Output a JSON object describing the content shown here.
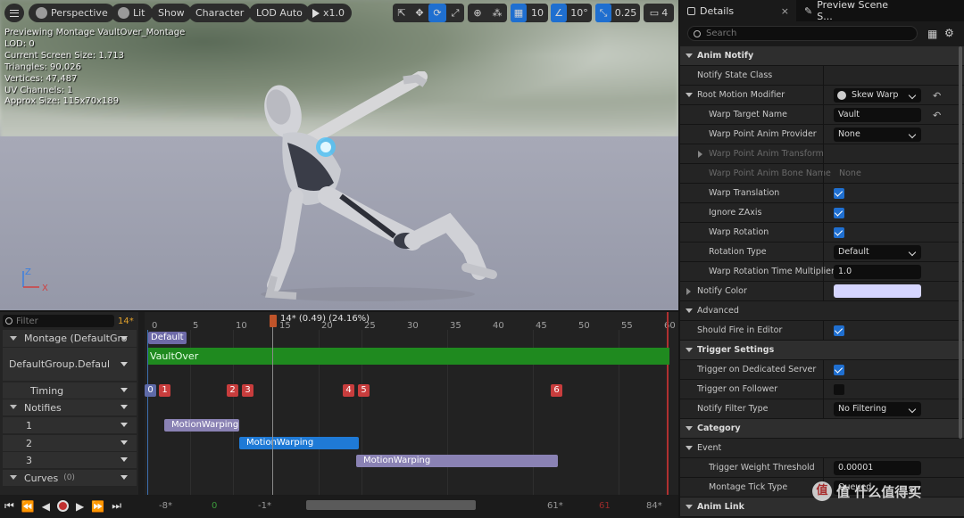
{
  "viewport": {
    "toolbar": {
      "perspective": "Perspective",
      "lit": "Lit",
      "show": "Show",
      "character": "Character",
      "lod": "LOD Auto",
      "play_speed": "x1.0",
      "grid_snap": "10",
      "angle_snap": "10°",
      "scale_snap": "0.25",
      "camera_speed": "4"
    },
    "stats": [
      "Previewing Montage VaultOver_Montage",
      "LOD: 0",
      "Current Screen Size: 1.713",
      "Triangles: 90,026",
      "Vertices: 47,487",
      "UV Channels: 1",
      "Approx Size: 115x70x189"
    ],
    "axis": {
      "z": "Z",
      "x": "X"
    }
  },
  "timeline": {
    "filter_placeholder": "Filter",
    "current_frame": "14*",
    "playhead_label": "14* (0.49) (24.16%)",
    "ticks": [
      "0",
      "5",
      "10",
      "15",
      "20",
      "25",
      "30",
      "35",
      "40",
      "45",
      "50",
      "55",
      "60"
    ],
    "rows": {
      "montage": "Montage (DefaultGro",
      "group": "DefaultGroup.Defaul",
      "timing": "Timing",
      "notifies": "Notifies",
      "track1": "1",
      "track2": "2",
      "track3": "3",
      "curves": "Curves",
      "curves_count": "(0)"
    },
    "slot_default": "Default",
    "section_name": "VaultOver",
    "timing_markers": [
      "0",
      "1",
      "2",
      "3",
      "4",
      "5",
      "6"
    ],
    "notifies": [
      "MotionWarping",
      "MotionWarping",
      "MotionWarping"
    ],
    "bottom": {
      "range_start": "-8*",
      "zero": "0",
      "neg1": "-1*",
      "end1": "61*",
      "end2": "61",
      "end3": "84*"
    }
  },
  "details": {
    "tab_details": "Details",
    "tab_preview": "Preview Scene S...",
    "search_placeholder": "Search",
    "rows": {
      "anim_notify": "Anim Notify",
      "notify_state_class": "Notify State Class",
      "root_motion_modifier": "Root Motion Modifier",
      "root_motion_value": "Skew Warp",
      "warp_target_name": "Warp Target Name",
      "warp_target_value": "Vault",
      "warp_point_provider": "Warp Point Anim Provider",
      "warp_point_provider_value": "None",
      "warp_point_transform": "Warp Point Anim Transform",
      "warp_point_bone": "Warp Point Anim Bone Name",
      "warp_point_bone_value": "None",
      "warp_translation": "Warp Translation",
      "ignore_zaxis": "Ignore ZAxis",
      "warp_rotation": "Warp Rotation",
      "rotation_type": "Rotation Type",
      "rotation_type_value": "Default",
      "warp_rotation_mult": "Warp Rotation Time Multiplier",
      "warp_rotation_mult_value": "1.0",
      "notify_color": "Notify Color",
      "advanced": "Advanced",
      "fire_in_editor": "Should Fire in Editor",
      "trigger_settings": "Trigger Settings",
      "trigger_dedicated": "Trigger on Dedicated Server",
      "trigger_follower": "Trigger on Follower",
      "notify_filter_type": "Notify Filter Type",
      "notify_filter_value": "No Filtering",
      "category": "Category",
      "event": "Event",
      "trigger_weight": "Trigger Weight Threshold",
      "trigger_weight_value": "0.00001",
      "montage_tick_type": "Montage Tick Type",
      "montage_tick_value": "Queued",
      "anim_link": "Anim Link"
    }
  },
  "colors": {
    "accent_blue": "#1f6fd0",
    "section_green": "#1e8a1e",
    "notify_purple": "#8a82b4",
    "marker_red": "#c83d3d",
    "notify_color_swatch": "#d6d6ff"
  },
  "watermark": "值 什么值得买"
}
